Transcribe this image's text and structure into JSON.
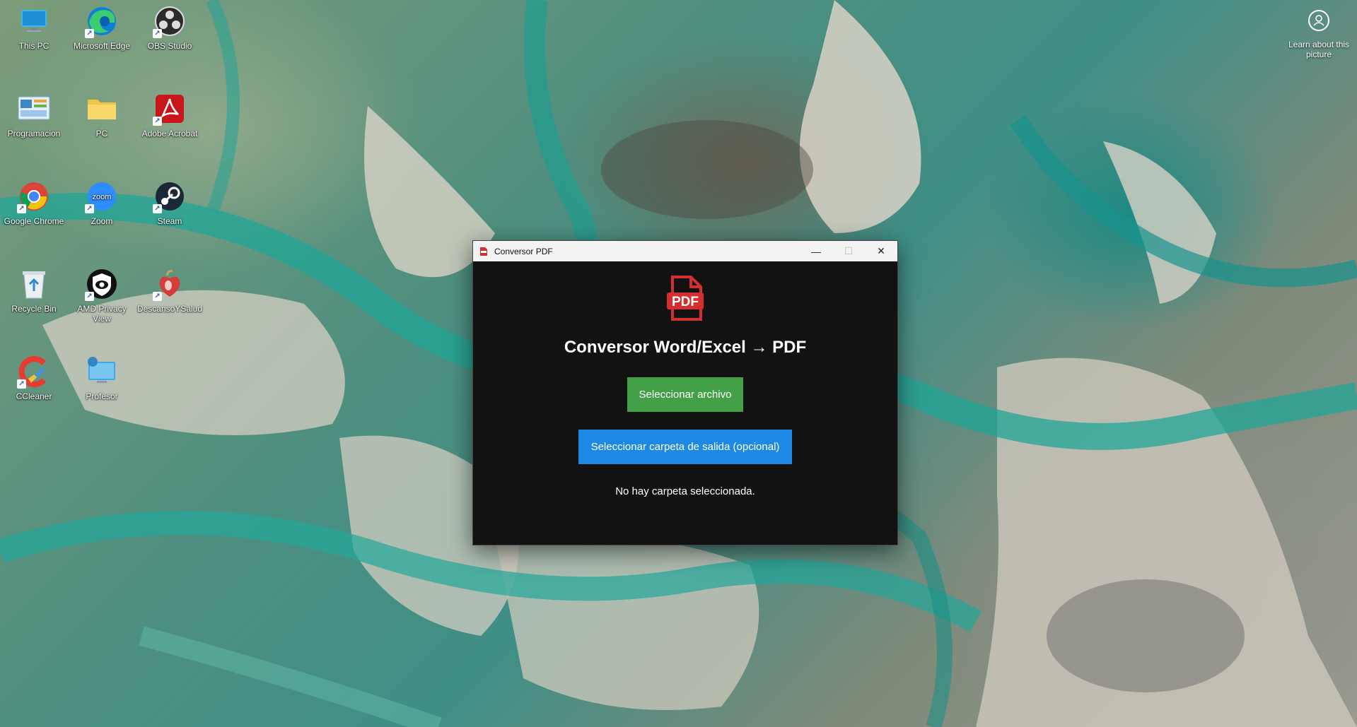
{
  "desktop": {
    "icons": [
      {
        "label": "This PC",
        "icon": "monitor-icon"
      },
      {
        "label": "Microsoft Edge",
        "icon": "edge-icon"
      },
      {
        "label": "OBS Studio",
        "icon": "obs-icon"
      },
      {
        "label": "Programacion",
        "icon": "programacion-icon"
      },
      {
        "label": "PC",
        "icon": "folder-icon"
      },
      {
        "label": "Adobe Acrobat",
        "icon": "acrobat-icon"
      },
      {
        "label": "Google Chrome",
        "icon": "chrome-icon"
      },
      {
        "label": "Zoom",
        "icon": "zoom-icon"
      },
      {
        "label": "Steam",
        "icon": "steam-icon"
      },
      {
        "label": "Recycle Bin",
        "icon": "recycle-bin-icon"
      },
      {
        "label": "AMD Privacy View",
        "icon": "amd-privacy-icon"
      },
      {
        "label": "DescansoYSalud",
        "icon": "descanso-icon"
      },
      {
        "label": "CCleaner",
        "icon": "ccleaner-icon"
      },
      {
        "label": "Profesor",
        "icon": "profesor-icon"
      }
    ],
    "zoom_icon_text": "zoom",
    "learn_label": "Learn about this picture"
  },
  "window": {
    "title": "Conversor PDF",
    "minimize_symbol": "—",
    "maximize_symbol": "☐",
    "close_symbol": "✕",
    "logo_text": "PDF",
    "heading": "Conversor Word/Excel → PDF",
    "select_file_label": "Seleccionar archivo",
    "select_folder_label": "Seleccionar carpeta de salida (opcional)",
    "status_text": "No hay carpeta seleccionada."
  },
  "colors": {
    "window_bg": "#121212",
    "file_button": "#43a047",
    "folder_button": "#1e88e5",
    "pdf_red": "#d32f2f"
  }
}
